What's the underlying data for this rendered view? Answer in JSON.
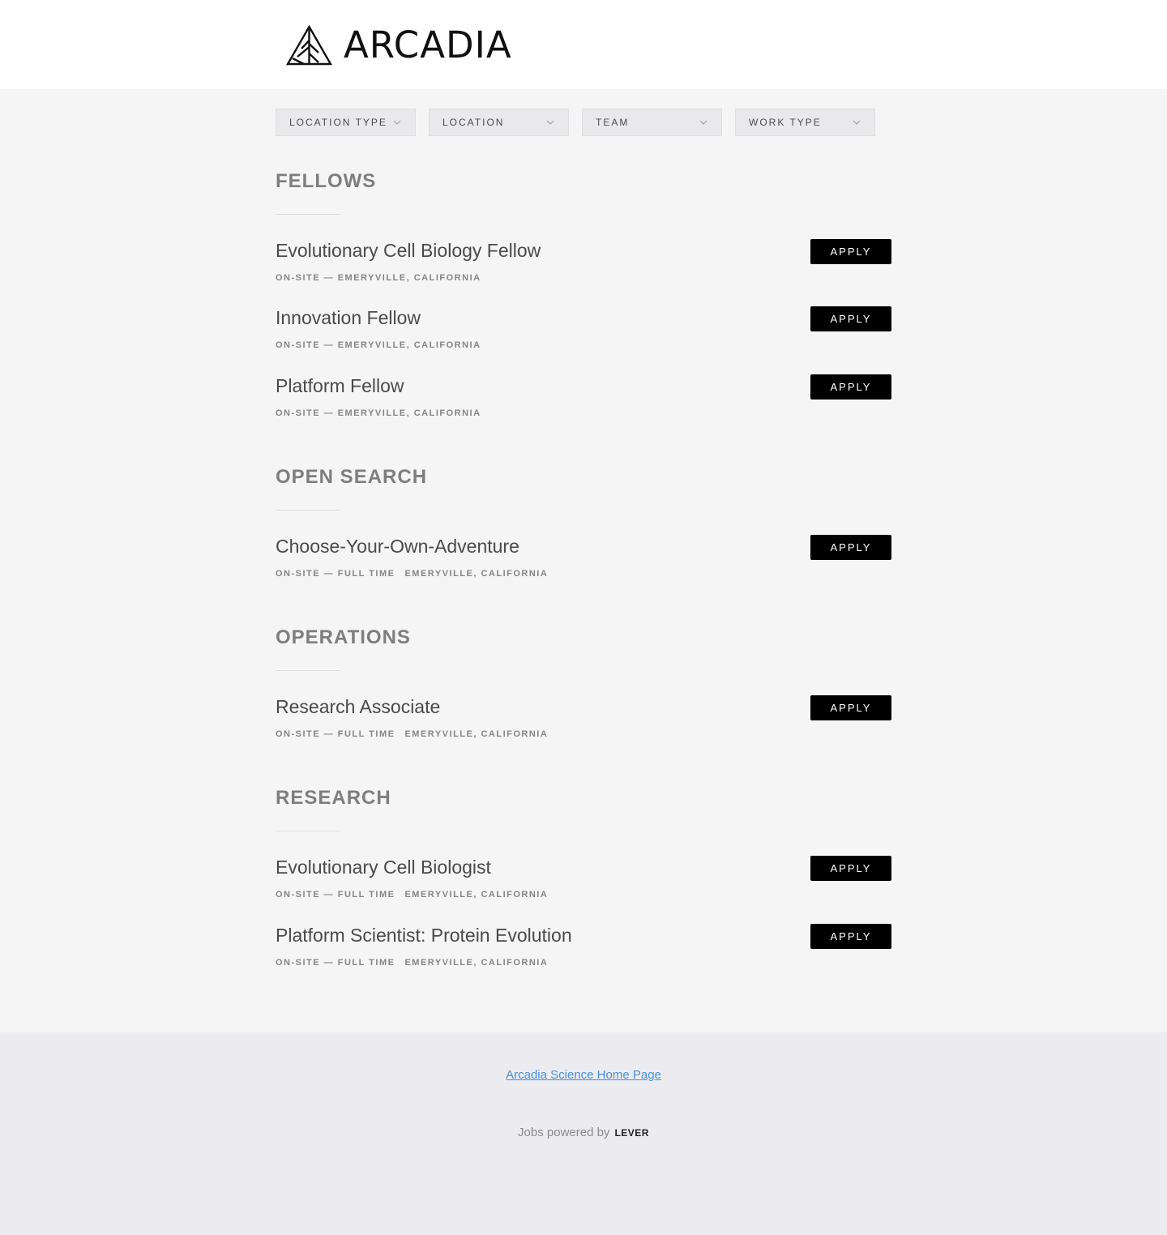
{
  "brand": {
    "name": "ARCADIA"
  },
  "filters": [
    {
      "label": "LOCATION TYPE"
    },
    {
      "label": "LOCATION"
    },
    {
      "label": "TEAM"
    },
    {
      "label": "WORK TYPE"
    }
  ],
  "sections": [
    {
      "title": "FELLOWS",
      "postings": [
        {
          "title": "Evolutionary Cell Biology Fellow",
          "meta": "ON-SITE — EMERYVILLE, CALIFORNIA",
          "location": "",
          "apply": "APPLY"
        },
        {
          "title": "Innovation Fellow",
          "meta": "ON-SITE — EMERYVILLE, CALIFORNIA",
          "location": "",
          "apply": "APPLY"
        },
        {
          "title": "Platform Fellow",
          "meta": "ON-SITE — EMERYVILLE, CALIFORNIA",
          "location": "",
          "apply": "APPLY"
        }
      ]
    },
    {
      "title": "OPEN SEARCH",
      "postings": [
        {
          "title": "Choose-Your-Own-Adventure",
          "meta": "ON-SITE — FULL TIME",
          "location": "EMERYVILLE, CALIFORNIA",
          "apply": "APPLY"
        }
      ]
    },
    {
      "title": "OPERATIONS",
      "postings": [
        {
          "title": "Research Associate",
          "meta": "ON-SITE — FULL TIME",
          "location": "EMERYVILLE, CALIFORNIA",
          "apply": "APPLY"
        }
      ]
    },
    {
      "title": "RESEARCH",
      "postings": [
        {
          "title": "Evolutionary Cell Biologist",
          "meta": "ON-SITE — FULL TIME",
          "location": "EMERYVILLE, CALIFORNIA",
          "apply": "APPLY"
        },
        {
          "title": "Platform Scientist: Protein Evolution",
          "meta": "ON-SITE — FULL TIME",
          "location": "EMERYVILLE, CALIFORNIA",
          "apply": "APPLY"
        }
      ]
    }
  ],
  "footer": {
    "home_link": "Arcadia Science Home Page",
    "powered_by": "Jobs powered by",
    "powered_brand": "LEVER"
  },
  "colors": {
    "apply_bg": "#000000",
    "link": "#4a90d9",
    "page_bg": "#f5f5f6",
    "footer_bg": "#ececf0"
  }
}
